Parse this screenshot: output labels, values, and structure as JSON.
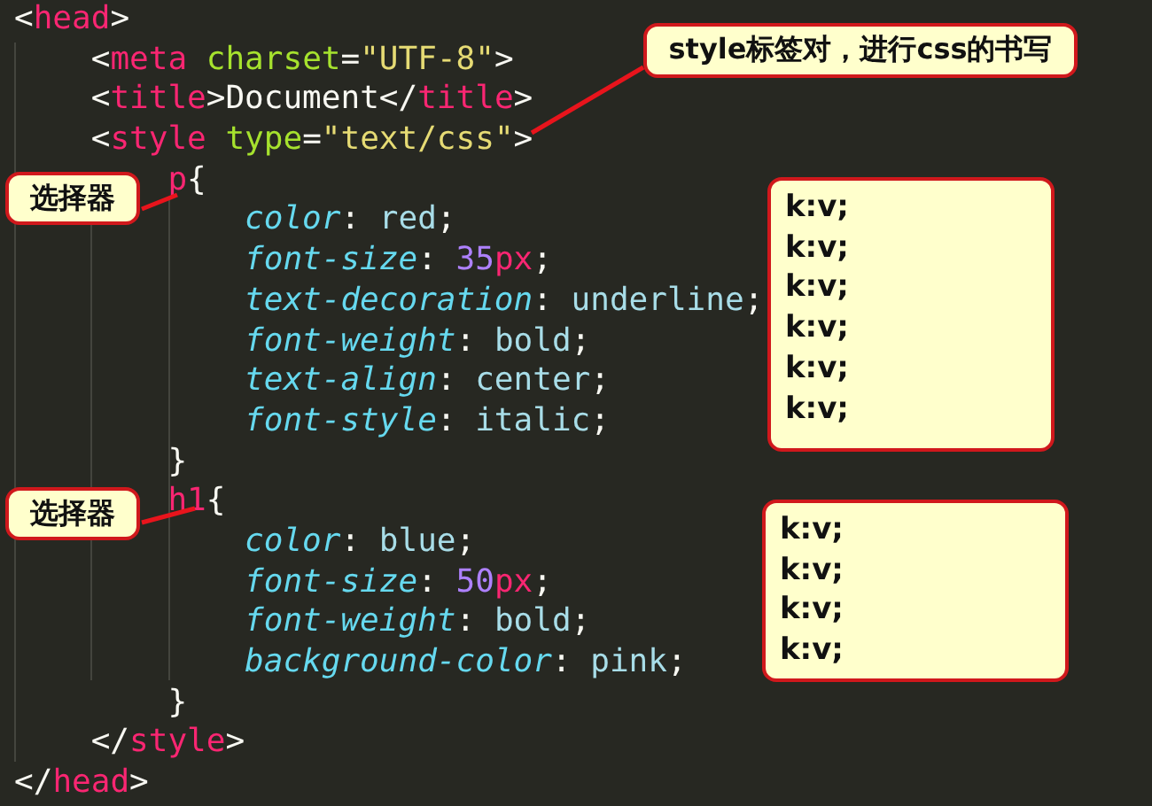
{
  "code_lines": [
    {
      "tokens": [
        {
          "text": "<",
          "kind": "punct"
        },
        {
          "text": "head",
          "kind": "tag"
        },
        {
          "text": ">",
          "kind": "punct"
        }
      ]
    },
    {
      "tokens": [
        {
          "text": "    <",
          "kind": "punct"
        },
        {
          "text": "meta",
          "kind": "tag"
        },
        {
          "text": " charset",
          "kind": "attr"
        },
        {
          "text": "=",
          "kind": "punct"
        },
        {
          "text": "\"UTF-8\"",
          "kind": "string"
        },
        {
          "text": ">",
          "kind": "punct"
        }
      ]
    },
    {
      "tokens": [
        {
          "text": "    <",
          "kind": "punct"
        },
        {
          "text": "title",
          "kind": "tag"
        },
        {
          "text": ">Document</",
          "kind": "punct"
        },
        {
          "text": "title",
          "kind": "tag"
        },
        {
          "text": ">",
          "kind": "punct"
        }
      ]
    },
    {
      "tokens": [
        {
          "text": "    <",
          "kind": "punct"
        },
        {
          "text": "style",
          "kind": "tag"
        },
        {
          "text": " type",
          "kind": "attr"
        },
        {
          "text": "=",
          "kind": "punct"
        },
        {
          "text": "\"text/css\"",
          "kind": "string"
        },
        {
          "text": ">",
          "kind": "punct"
        }
      ]
    },
    {
      "tokens": [
        {
          "text": "        p",
          "kind": "tag"
        },
        {
          "text": "{",
          "kind": "punct"
        }
      ]
    },
    {
      "tokens": [
        {
          "text": "            color",
          "kind": "prop"
        },
        {
          "text": ": ",
          "kind": "punct"
        },
        {
          "text": "red",
          "kind": "value"
        },
        {
          "text": ";",
          "kind": "punct"
        }
      ]
    },
    {
      "tokens": [
        {
          "text": "            font-size",
          "kind": "prop"
        },
        {
          "text": ": ",
          "kind": "punct"
        },
        {
          "text": "35",
          "kind": "number"
        },
        {
          "text": "px",
          "kind": "tag"
        },
        {
          "text": ";",
          "kind": "punct"
        }
      ]
    },
    {
      "tokens": [
        {
          "text": "            text-decoration",
          "kind": "prop"
        },
        {
          "text": ": ",
          "kind": "punct"
        },
        {
          "text": "underline",
          "kind": "value"
        },
        {
          "text": ";",
          "kind": "punct"
        }
      ]
    },
    {
      "tokens": [
        {
          "text": "            font-weight",
          "kind": "prop"
        },
        {
          "text": ": ",
          "kind": "punct"
        },
        {
          "text": "bold",
          "kind": "value"
        },
        {
          "text": ";",
          "kind": "punct"
        }
      ]
    },
    {
      "tokens": [
        {
          "text": "            text-align",
          "kind": "prop"
        },
        {
          "text": ": ",
          "kind": "punct"
        },
        {
          "text": "center",
          "kind": "value"
        },
        {
          "text": ";",
          "kind": "punct"
        }
      ]
    },
    {
      "tokens": [
        {
          "text": "            font-style",
          "kind": "prop"
        },
        {
          "text": ": ",
          "kind": "punct"
        },
        {
          "text": "italic",
          "kind": "value"
        },
        {
          "text": ";",
          "kind": "punct"
        }
      ]
    },
    {
      "tokens": [
        {
          "text": "        }",
          "kind": "punct"
        }
      ]
    },
    {
      "tokens": [
        {
          "text": "        h1",
          "kind": "tag"
        },
        {
          "text": "{",
          "kind": "punct"
        }
      ]
    },
    {
      "tokens": [
        {
          "text": "            color",
          "kind": "prop"
        },
        {
          "text": ": ",
          "kind": "punct"
        },
        {
          "text": "blue",
          "kind": "value"
        },
        {
          "text": ";",
          "kind": "punct"
        }
      ]
    },
    {
      "tokens": [
        {
          "text": "            font-size",
          "kind": "prop"
        },
        {
          "text": ": ",
          "kind": "punct"
        },
        {
          "text": "50",
          "kind": "number"
        },
        {
          "text": "px",
          "kind": "tag"
        },
        {
          "text": ";",
          "kind": "punct"
        }
      ]
    },
    {
      "tokens": [
        {
          "text": "            font-weight",
          "kind": "prop"
        },
        {
          "text": ": ",
          "kind": "punct"
        },
        {
          "text": "bold",
          "kind": "value"
        },
        {
          "text": ";",
          "kind": "punct"
        }
      ]
    },
    {
      "tokens": [
        {
          "text": "            background-color",
          "kind": "prop"
        },
        {
          "text": ": ",
          "kind": "punct"
        },
        {
          "text": "pink",
          "kind": "value"
        },
        {
          "text": ";",
          "kind": "punct"
        }
      ]
    },
    {
      "tokens": [
        {
          "text": "        }",
          "kind": "punct"
        }
      ]
    },
    {
      "tokens": [
        {
          "text": "    </",
          "kind": "punct"
        },
        {
          "text": "style",
          "kind": "tag"
        },
        {
          "text": ">",
          "kind": "punct"
        }
      ]
    },
    {
      "tokens": [
        {
          "text": "</",
          "kind": "punct"
        },
        {
          "text": "head",
          "kind": "tag"
        },
        {
          "text": ">",
          "kind": "punct"
        }
      ]
    }
  ],
  "callouts": [
    {
      "kind": "note",
      "text": "style标签对，进行css的书写"
    },
    {
      "kind": "note",
      "text": "选择器"
    },
    {
      "kind": "list",
      "lines": [
        "k:v;",
        "k:v;",
        "k:v;",
        "k:v;",
        "k:v;",
        "k:v;"
      ]
    },
    {
      "kind": "note",
      "text": "选择器"
    },
    {
      "kind": "list",
      "lines": [
        "k:v;",
        "k:v;",
        "k:v;",
        "k:v;"
      ]
    }
  ]
}
